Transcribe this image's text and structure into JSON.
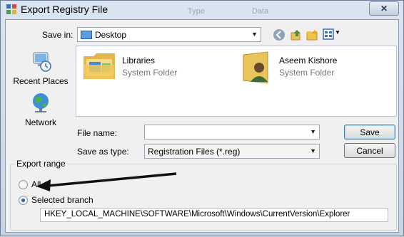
{
  "window": {
    "title": "Export Registry File",
    "ghost_type": "Type",
    "ghost_data": "Data",
    "close_glyph": "✕"
  },
  "toolbar": {
    "save_in_label": "Save in:",
    "save_in_value": "Desktop"
  },
  "places": [
    {
      "label": "Recent Places",
      "icon": "recent-places-icon"
    },
    {
      "label": "Network",
      "icon": "network-icon"
    }
  ],
  "files": [
    {
      "name": "Libraries",
      "type": "System Folder",
      "icon": "libraries-folder-icon"
    },
    {
      "name": "Aseem Kishore",
      "type": "System Folder",
      "icon": "user-folder-icon"
    }
  ],
  "form": {
    "file_name_label": "File name:",
    "file_name_value": "",
    "save_as_label": "Save as type:",
    "save_as_value": "Registration Files (*.reg)"
  },
  "buttons": {
    "save": "Save",
    "cancel": "Cancel"
  },
  "export_range": {
    "title": "Export range",
    "all_label": "All",
    "selected_label": "Selected branch",
    "selected": "Selected branch",
    "branch_path": "HKEY_LOCAL_MACHINE\\SOFTWARE\\Microsoft\\Windows\\CurrentVersion\\Explorer"
  },
  "colors": {
    "arrow": "#111111",
    "title_bar": "#dbe5f1",
    "accent": "#3c7fb1"
  }
}
